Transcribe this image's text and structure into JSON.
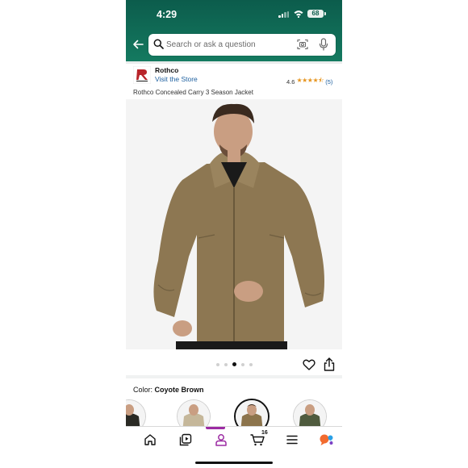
{
  "status_bar": {
    "time": "4:29",
    "battery": "68"
  },
  "search": {
    "placeholder": "Search or ask a question"
  },
  "store": {
    "brand_name": "Rothco",
    "visit_link": "Visit the Store",
    "rating": "4.6",
    "rating_stars": 4.5,
    "review_count": "(5)"
  },
  "product": {
    "title": "Rothco Concealed Carry 3 Season Jacket"
  },
  "gallery": {
    "image_count": 5,
    "active_index": 2
  },
  "color": {
    "label": "Color:",
    "selected": "Coyote Brown"
  },
  "swatches": [
    {
      "name": "black",
      "color": "#2a2a24"
    },
    {
      "name": "khaki",
      "color": "#c5b79a"
    },
    {
      "name": "coyote-brown",
      "color": "#8c744c",
      "selected": true
    },
    {
      "name": "olive-drab",
      "color": "#4f5b3e"
    }
  ],
  "bottom_nav": {
    "items": [
      "home-icon",
      "inspire-icon",
      "account-icon",
      "cart-icon",
      "menu-icon",
      "rufus-icon"
    ],
    "active": "account-icon",
    "cart_count": "16"
  },
  "colors": {
    "header_green": "#0c5c4c",
    "link_blue": "#2162a1",
    "star_orange": "#e6951f",
    "active_nav": "#9c2ba3"
  }
}
